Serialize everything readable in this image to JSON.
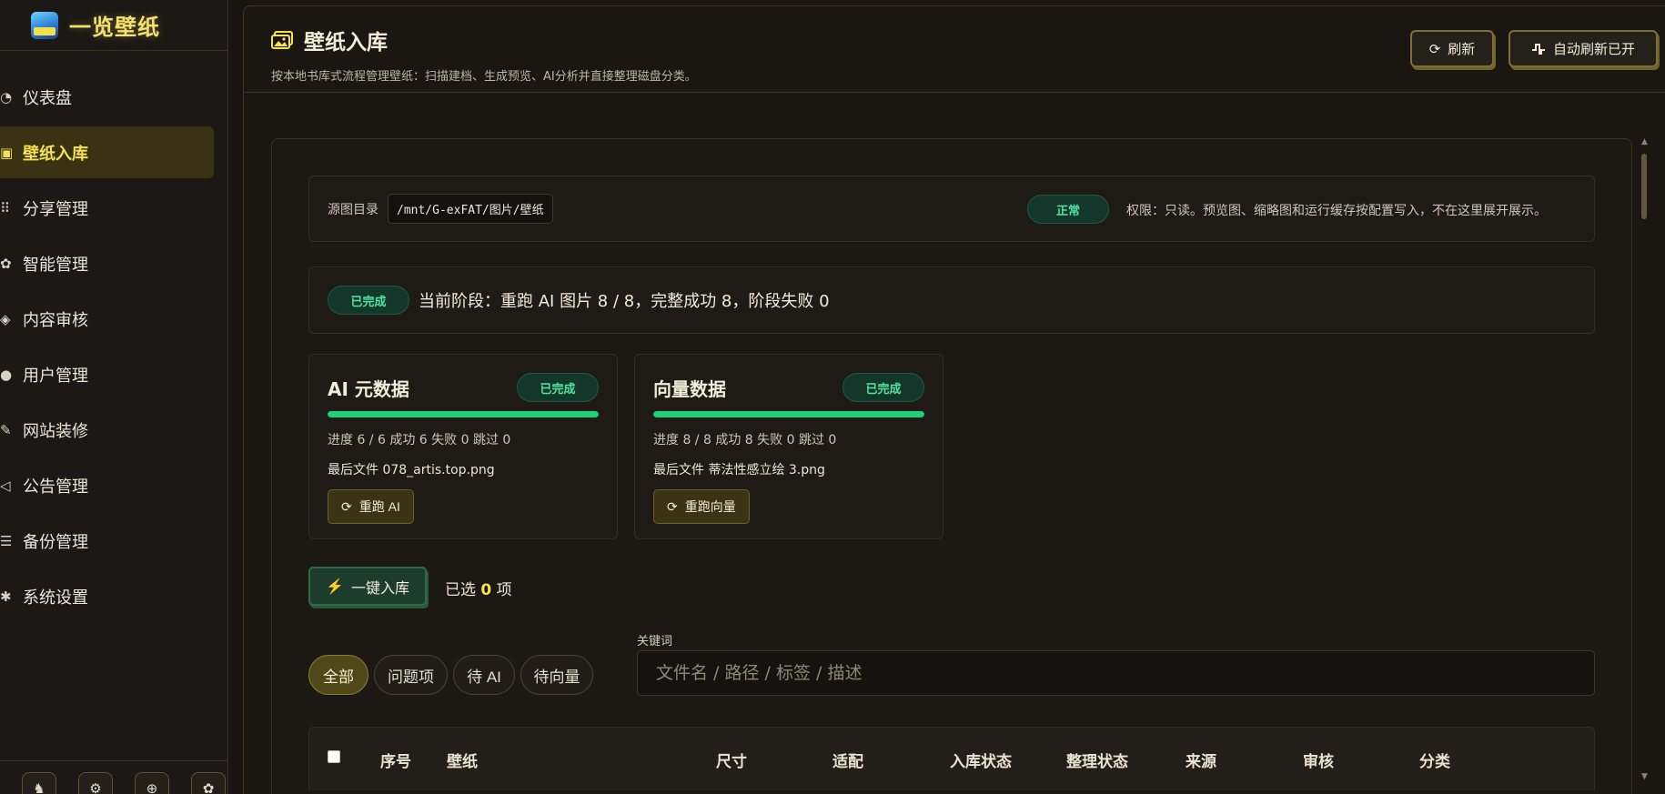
{
  "brand": {
    "title": "一览壁纸"
  },
  "sidebar": {
    "items": [
      {
        "label": "仪表盘",
        "icon": "dashboard-icon",
        "glyph": "◔"
      },
      {
        "label": "壁纸入库",
        "icon": "image-icon",
        "glyph": "▣",
        "active": true
      },
      {
        "label": "分享管理",
        "icon": "share-icon",
        "glyph": "⠿"
      },
      {
        "label": "智能管理",
        "icon": "brain-icon",
        "glyph": "✿"
      },
      {
        "label": "内容审核",
        "icon": "review-icon",
        "glyph": "◈"
      },
      {
        "label": "用户管理",
        "icon": "users-icon",
        "glyph": "●"
      },
      {
        "label": "网站装修",
        "icon": "brush-icon",
        "glyph": "✎"
      },
      {
        "label": "公告管理",
        "icon": "megaphone-icon",
        "glyph": "◁"
      },
      {
        "label": "备份管理",
        "icon": "database-icon",
        "glyph": "☰"
      },
      {
        "label": "系统设置",
        "icon": "gear-icon",
        "glyph": "✱"
      }
    ],
    "bottom_buttons": [
      {
        "icon": "cat-icon",
        "glyph": "♞"
      },
      {
        "icon": "robot-icon",
        "glyph": "⚙"
      },
      {
        "icon": "globe-icon",
        "glyph": "⊕"
      },
      {
        "icon": "settings-icon",
        "glyph": "✿"
      }
    ]
  },
  "header": {
    "title": "壁纸入库",
    "subtitle": "按本地书库式流程管理壁纸：扫描建档、生成预览、AI分析并直接整理磁盘分类。",
    "refresh_label": "刷新",
    "auto_refresh_label": "自动刷新已开"
  },
  "source": {
    "label": "源图目录",
    "path": "/mnt/G-exFAT/图片/壁纸",
    "status": "正常",
    "permission": "权限：只读。预览图、缩略图和运行缓存按配置写入，不在这里展开展示。"
  },
  "stage": {
    "badge": "已完成",
    "text": "当前阶段：重跑 AI 图片 8 / 8，完整成功 8，阶段失败 0"
  },
  "ai_card": {
    "title": "AI 元数据",
    "badge": "已完成",
    "progress": 1.0,
    "stats": "进度 6 / 6 成功 6 失败 0 跳过 0",
    "last_file": "最后文件 078_artis.top.png",
    "button": "重跑 AI"
  },
  "vector_card": {
    "title": "向量数据",
    "badge": "已完成",
    "progress": 1.0,
    "stats": "进度 8 / 8 成功 8 失败 0 跳过 0",
    "last_file": "最后文件 蒂法性感立绘 3.png",
    "button": "重跑向量"
  },
  "actions": {
    "ingest_label": "一键入库",
    "selected_prefix": "已选",
    "selected_count": "0",
    "selected_suffix": "项"
  },
  "filters": {
    "tabs": [
      "全部",
      "问题项",
      "待 AI",
      "待向量"
    ],
    "active": "全部",
    "keyword_label": "关键词",
    "keyword_placeholder": "文件名 / 路径 / 标签 / 描述",
    "keyword_value": ""
  },
  "table": {
    "columns": [
      "序号",
      "壁纸",
      "尺寸",
      "适配",
      "入库状态",
      "整理状态",
      "来源",
      "审核",
      "分类"
    ]
  },
  "colors": {
    "accent": "#f6e155",
    "success": "#1fd07a",
    "background": "#171411"
  }
}
